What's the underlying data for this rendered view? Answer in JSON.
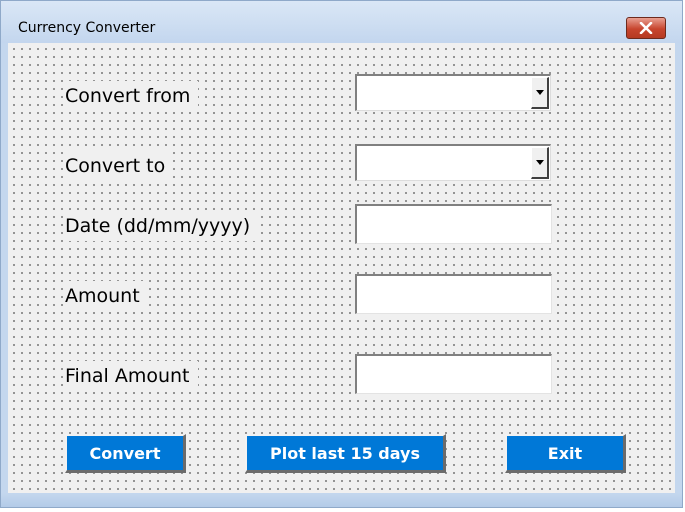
{
  "window": {
    "title": "Currency Converter"
  },
  "form": {
    "convert_from_label": "Convert from",
    "convert_from_value": "",
    "convert_to_label": "Convert to",
    "convert_to_value": "",
    "date_label": "Date (dd/mm/yyyy)",
    "date_value": "",
    "amount_label": "Amount",
    "amount_value": "",
    "final_amount_label": "Final Amount",
    "final_amount_value": ""
  },
  "buttons": {
    "convert_label": "Convert",
    "plot_label": "Plot last 15 days",
    "exit_label": "Exit"
  },
  "colors": {
    "button_accent": "#0078d7",
    "close_button": "#c7452e"
  },
  "icons": {
    "close": "close-icon",
    "dropdown": "chevron-down-icon"
  }
}
